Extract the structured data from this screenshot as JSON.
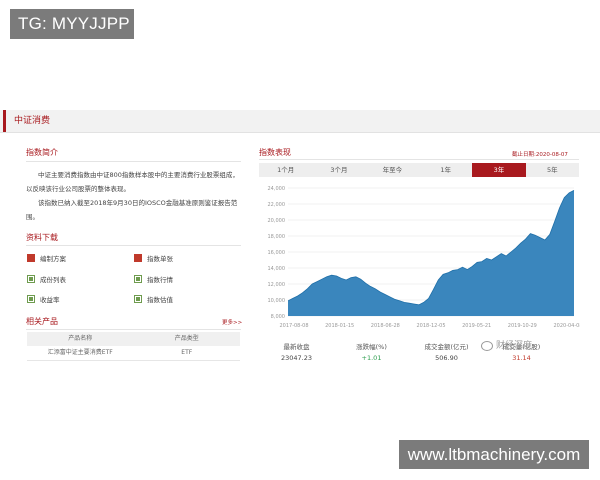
{
  "watermarks": {
    "top_left": "TG: MYYJJPP",
    "bottom_right": "www.ltbmachinery.com",
    "weixin": "财经深度"
  },
  "tab": {
    "title": "中证消费"
  },
  "intro": {
    "heading": "指数简介",
    "para1": "中证主要消费指数由中证800指数样本股中的主要消费行业股票组成，以反映该行业公司股票的整体表现。",
    "para2": "该指数已纳入截至2018年9月30日的IOSCO金融基准原则鉴证报告范围。"
  },
  "downloads": {
    "heading": "资料下载",
    "items": [
      {
        "label": "编制方案",
        "icon": "pdf-icon"
      },
      {
        "label": "指数单张",
        "icon": "pdf-icon"
      },
      {
        "label": "成份列表",
        "icon": "spreadsheet-icon"
      },
      {
        "label": "指数行情",
        "icon": "spreadsheet-icon"
      },
      {
        "label": "收益率",
        "icon": "spreadsheet-icon"
      },
      {
        "label": "指数估值",
        "icon": "spreadsheet-icon"
      }
    ]
  },
  "related": {
    "heading": "相关产品",
    "more": "更多>>",
    "columns": [
      "产品名称",
      "产品类型"
    ],
    "rows": [
      [
        "汇添富中证主要消费ETF",
        "ETF"
      ]
    ]
  },
  "performance": {
    "heading": "指数表现",
    "as_of": "截止日期:2020-08-07",
    "ranges": [
      "1个月",
      "3个月",
      "年至今",
      "1年",
      "3年",
      "5年"
    ],
    "active_range": "3年",
    "stats_labels": [
      "最新收盘",
      "涨跌幅(%)",
      "成交金额(亿元)",
      "成交量(亿股)"
    ],
    "stats_values": [
      "23047.23",
      "+1.01",
      "506.90",
      "31.14"
    ]
  },
  "colors": {
    "accent": "#a8191e",
    "area_fill": "#3a86bd",
    "up": "#2e9e4f"
  },
  "chart_data": {
    "type": "area",
    "ylim": [
      8000,
      24000
    ],
    "y_ticks": [
      "8,000",
      "10,000",
      "12,000",
      "14,000",
      "16,000",
      "18,000",
      "20,000",
      "22,000",
      "24,000"
    ],
    "x_ticks": [
      "2017-08-08",
      "2018-01-15",
      "2018-06-28",
      "2018-12-05",
      "2019-05-21",
      "2019-10-29",
      "2020-04-08"
    ],
    "series": [
      {
        "values": [
          9900,
          10200,
          10500,
          10900,
          11400,
          12000,
          12300,
          12600,
          12900,
          13100,
          13000,
          12700,
          12500,
          12800,
          12900,
          12600,
          12100,
          11700,
          11400,
          11000,
          10700,
          10400,
          10100,
          9900,
          9700,
          9600,
          9500,
          9400,
          9700,
          10200,
          11300,
          12500,
          13200,
          13400,
          13700,
          13800,
          14100,
          13800,
          14200,
          14700,
          14800,
          15200,
          15000,
          15400,
          15800,
          15500,
          16000,
          16500,
          17100,
          17600,
          18300,
          18100,
          17800,
          17500,
          18200,
          19800,
          21500,
          22800,
          23400,
          23700
        ]
      }
    ]
  }
}
